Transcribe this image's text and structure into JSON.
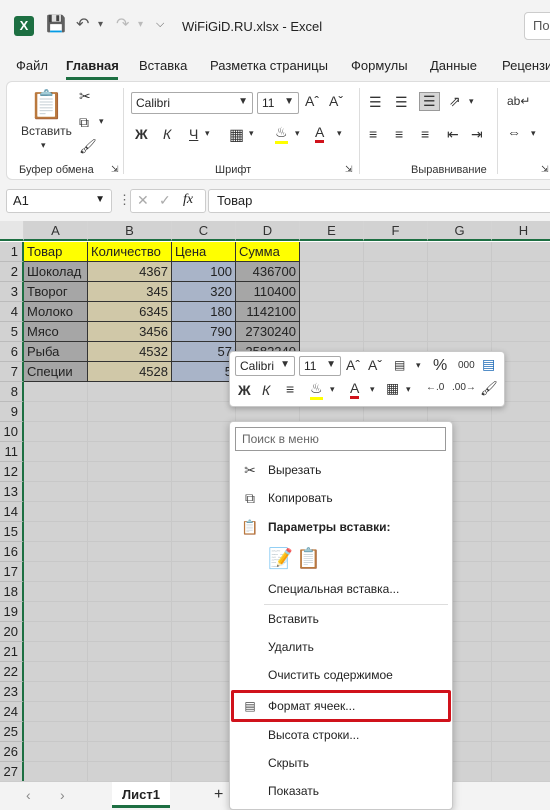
{
  "window": {
    "title": "WiFiGiD.RU.xlsx  -  Excel",
    "search_placeholder": "Пои"
  },
  "tabs": [
    "Файл",
    "Главная",
    "Вставка",
    "Разметка страницы",
    "Формулы",
    "Данные",
    "Рецензи"
  ],
  "active_tab": "Главная",
  "ribbon": {
    "clipboard": {
      "label": "Буфер обмена",
      "paste": "Вставить"
    },
    "font": {
      "label": "Шрифт",
      "name": "Calibri",
      "size": "11",
      "bold": "Ж",
      "italic": "К",
      "underline": "Ч"
    },
    "align": {
      "label": "Выравнивание"
    }
  },
  "formula_bar": {
    "name_box": "A1",
    "fx": "fx",
    "value": "Товар"
  },
  "columns": [
    "A",
    "B",
    "C",
    "D",
    "E",
    "F",
    "G",
    "H"
  ],
  "rows": [
    "1",
    "2",
    "3",
    "4",
    "5",
    "6",
    "7",
    "8",
    "9",
    "10",
    "11",
    "12",
    "13",
    "14",
    "15",
    "16",
    "17",
    "18",
    "19",
    "20",
    "21",
    "22",
    "23",
    "24",
    "25",
    "26",
    "27"
  ],
  "table": {
    "headers": [
      "Товар",
      "Количество",
      "Цена",
      "Сумма"
    ],
    "rows": [
      [
        "Шоколад",
        "4367",
        "100",
        "436700"
      ],
      [
        "Творог",
        "345",
        "320",
        "110400"
      ],
      [
        "Молоко",
        "6345",
        "180",
        "1142100"
      ],
      [
        "Мясо",
        "3456",
        "790",
        "2730240"
      ],
      [
        "Рыба",
        "4532",
        "57",
        "2582240"
      ],
      [
        "Специи",
        "4528",
        "5",
        ""
      ]
    ]
  },
  "colors": {
    "header_yellow": "#ffff00",
    "col_a": "#a6a6a6",
    "col_b": "#d0c8a8",
    "col_c": "#a9b4c8",
    "col_d": "#a6a6a6",
    "accent": "#1d6f42",
    "highlight": "#d0121b"
  },
  "mini_toolbar": {
    "font": "Calibri",
    "size": "11",
    "percent": "%",
    "thousands": "000"
  },
  "context_menu": {
    "search_placeholder": "Поиск в меню",
    "items": [
      {
        "label": "Вырезать",
        "icon": "scissors-icon"
      },
      {
        "label": "Копировать",
        "icon": "copy-icon"
      },
      {
        "label": "Параметры вставки:",
        "icon": "paste-icon"
      },
      {
        "label": "Специальная вставка...",
        "icon": ""
      },
      {
        "label": "Вставить",
        "icon": ""
      },
      {
        "label": "Удалить",
        "icon": ""
      },
      {
        "label": "Очистить содержимое",
        "icon": ""
      },
      {
        "label": "Формат ячеек...",
        "icon": "format-cells-icon"
      },
      {
        "label": "Высота строки...",
        "icon": ""
      },
      {
        "label": "Скрыть",
        "icon": ""
      },
      {
        "label": "Показать",
        "icon": ""
      }
    ]
  },
  "sheet_tabs": {
    "active": "Лист1",
    "add": "+"
  }
}
